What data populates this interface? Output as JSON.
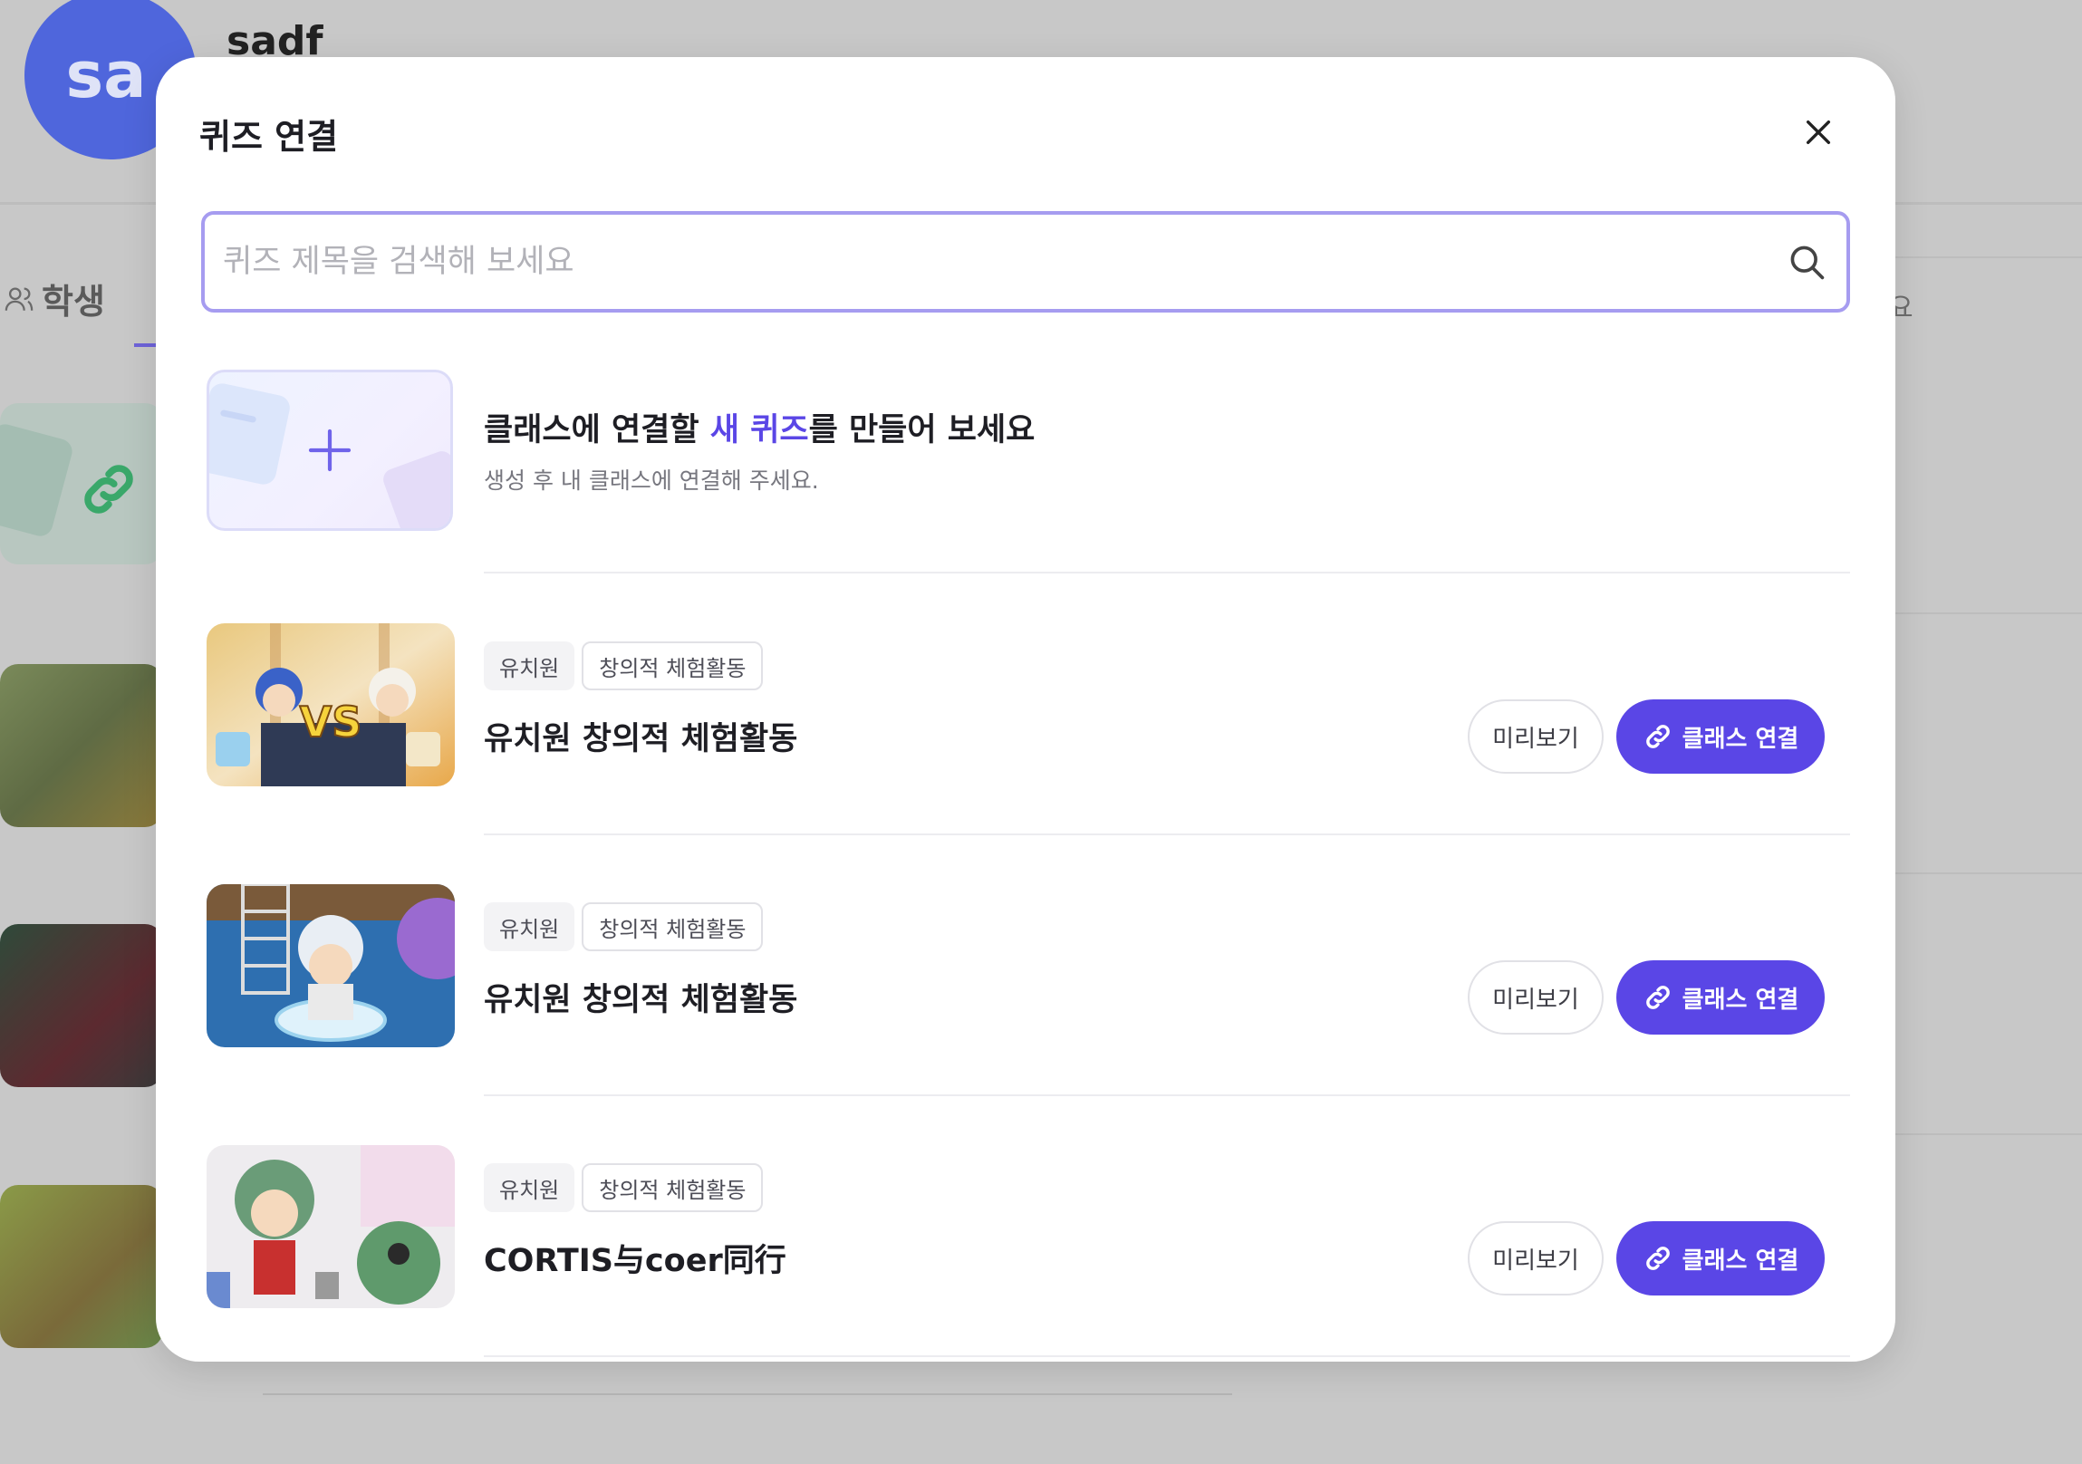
{
  "background": {
    "avatar_initials": "sa",
    "username": "sadf",
    "tab_student": "학생",
    "right_text": "요"
  },
  "modal": {
    "title": "퀴즈 연결",
    "close_icon": "close-icon",
    "search": {
      "placeholder": "퀴즈 제목을 검색해 보세요",
      "value": "",
      "icon": "search-icon"
    },
    "create": {
      "title_prefix": "클래스에 연결할 ",
      "title_accent": "새 퀴즈",
      "title_suffix": "를 만들어 보세요",
      "subtitle": "생성 후 내 클래스에 연결해 주세요.",
      "icon": "plus-icon"
    },
    "quizzes": [
      {
        "tags": [
          "유치원",
          "창의적 체험활동"
        ],
        "title": "유치원 창의적 체험활동",
        "preview_label": "미리보기",
        "connect_label": "클래스 연결",
        "thumb_text": "VS"
      },
      {
        "tags": [
          "유치원",
          "창의적 체험활동"
        ],
        "title": "유치원 창의적 체험활동",
        "preview_label": "미리보기",
        "connect_label": "클래스 연결",
        "thumb_text": ""
      },
      {
        "tags": [
          "유치원",
          "창의적 체험활동"
        ],
        "title": "CORTIS与coer同行",
        "preview_label": "미리보기",
        "connect_label": "클래스 연결",
        "thumb_text": ""
      }
    ]
  },
  "colors": {
    "accent": "#5a46e6",
    "search_border": "#a69cf0",
    "overlay": "#c8c8c8"
  }
}
